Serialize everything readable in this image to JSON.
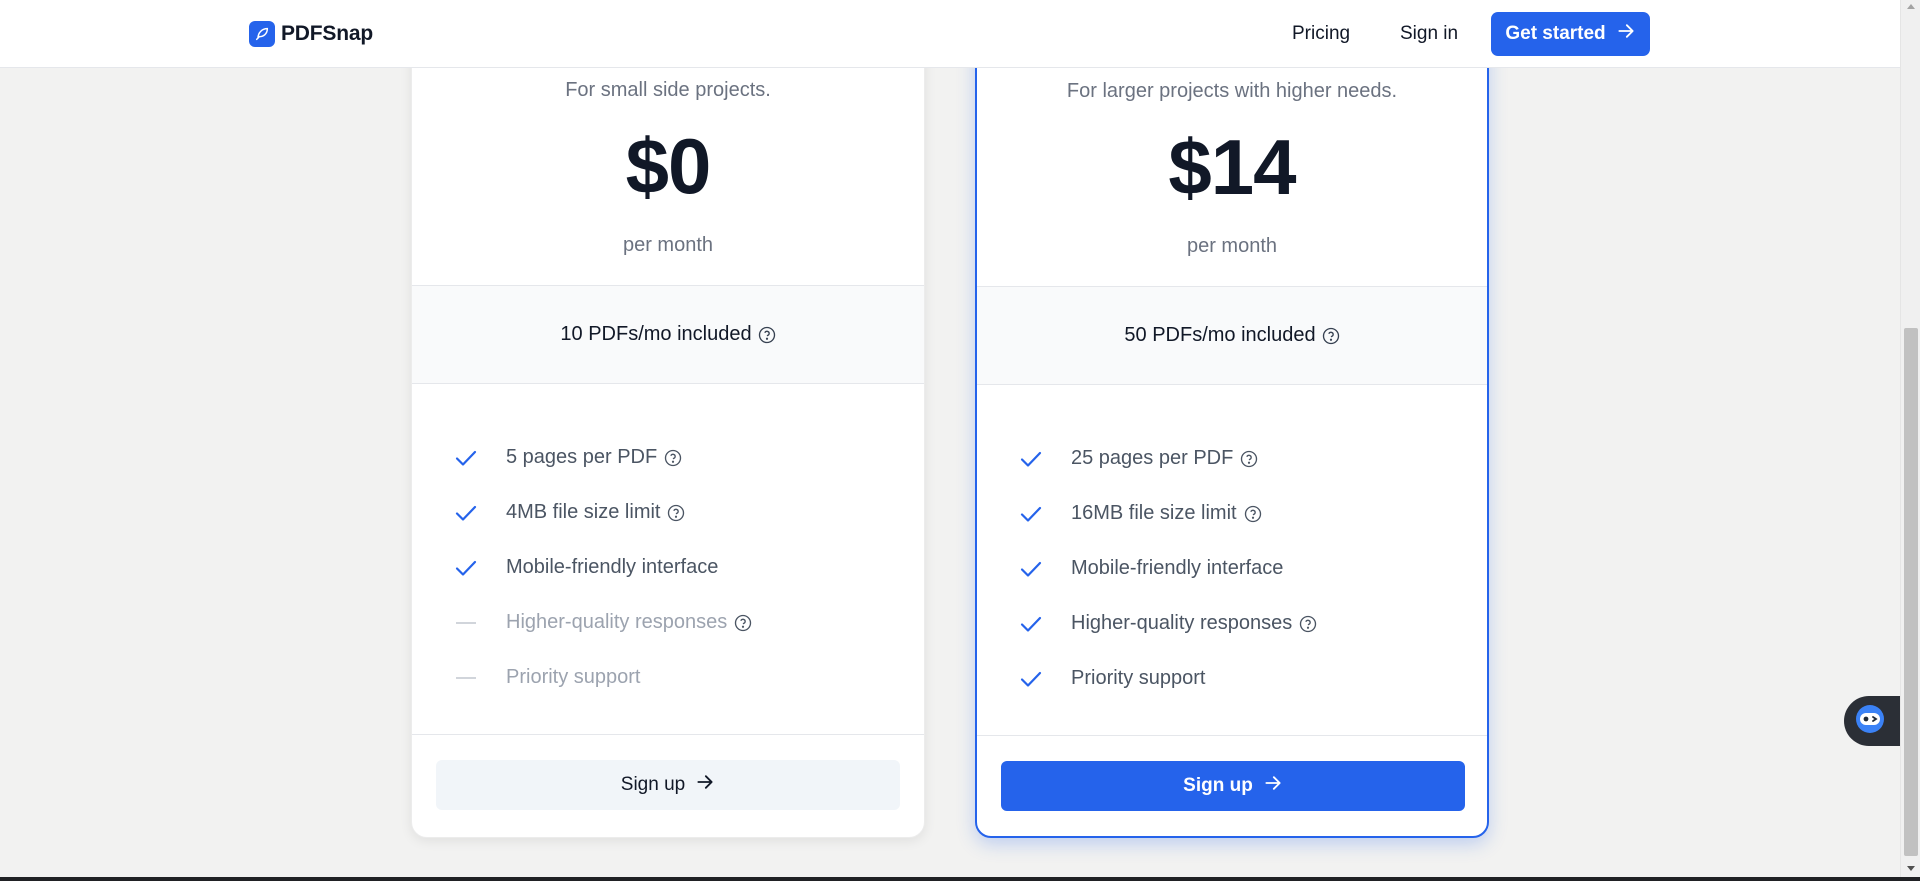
{
  "brand": {
    "name": "PDFSnap",
    "icon": "feather-icon",
    "accent": "#2563eb"
  },
  "nav": {
    "pricing": "Pricing",
    "sign_in": "Sign in",
    "get_started": "Get started"
  },
  "plans": [
    {
      "tagline": "For small side projects.",
      "price": "$0",
      "period": "per month",
      "quota": "10 PDFs/mo included",
      "features": [
        {
          "label": "5 pages per PDF",
          "included": true,
          "info": true
        },
        {
          "label": "4MB file size limit",
          "included": true,
          "info": true
        },
        {
          "label": "Mobile-friendly interface",
          "included": true,
          "info": false
        },
        {
          "label": "Higher-quality responses",
          "included": false,
          "info": true
        },
        {
          "label": "Priority support",
          "included": false,
          "info": false
        }
      ],
      "cta": "Sign up",
      "highlighted": false
    },
    {
      "tagline": "For larger projects with higher needs.",
      "price": "$14",
      "period": "per month",
      "quota": "50 PDFs/mo included",
      "features": [
        {
          "label": "25 pages per PDF",
          "included": true,
          "info": true
        },
        {
          "label": "16MB file size limit",
          "included": true,
          "info": true
        },
        {
          "label": "Mobile-friendly interface",
          "included": true,
          "info": false
        },
        {
          "label": "Higher-quality responses",
          "included": true,
          "info": true
        },
        {
          "label": "Priority support",
          "included": true,
          "info": false
        }
      ],
      "cta": "Sign up",
      "highlighted": true
    }
  ]
}
